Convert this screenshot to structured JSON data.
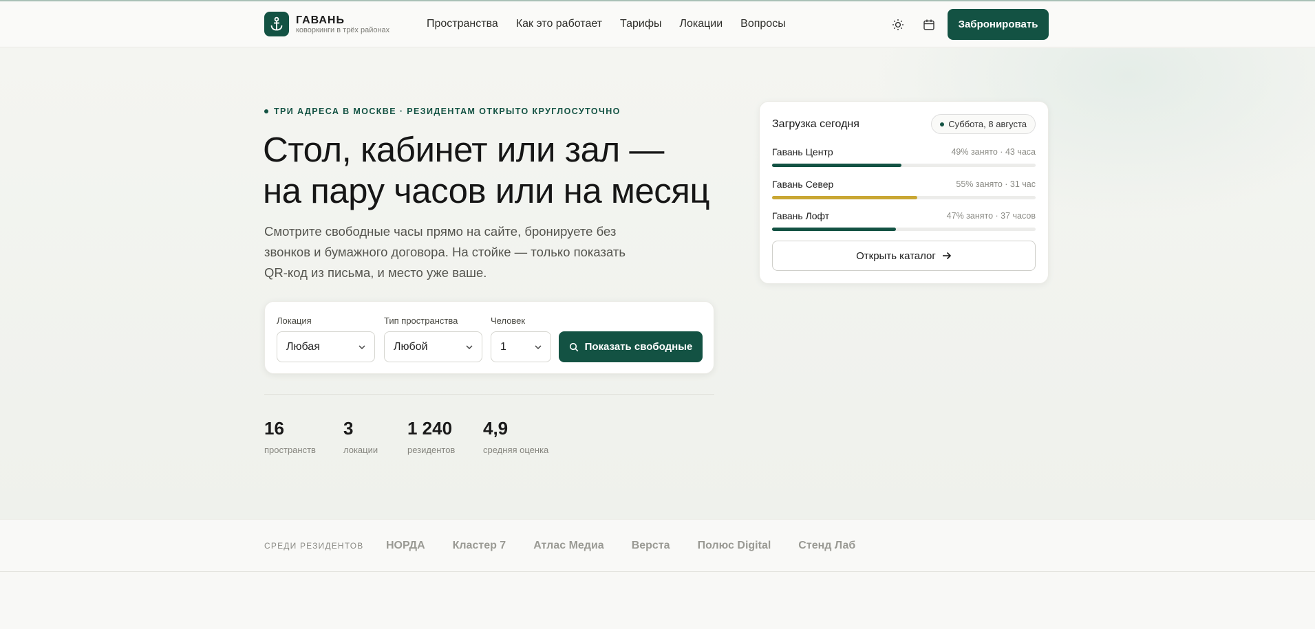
{
  "brand": {
    "name": "ГАВАНЬ",
    "tagline": "коворкинги в трёх районах",
    "accent_color": "#135243"
  },
  "nav": {
    "items": [
      {
        "label": "Пространства"
      },
      {
        "label": "Как это работает"
      },
      {
        "label": "Тарифы"
      },
      {
        "label": "Локации"
      },
      {
        "label": "Вопросы"
      }
    ],
    "theme_icon": "sun-icon",
    "calendar_icon": "calendar-icon",
    "book_label": "Забронировать"
  },
  "hero": {
    "eyebrow": "ТРИ АДРЕСА В МОСКВЕ · РЕЗИДЕНТАМ ОТКРЫТО КРУГЛОСУТОЧНО",
    "title_line1": "Стол, кабинет или зал —",
    "title_line2": "на пару часов или на месяц",
    "lead": "Смотрите свободные часы прямо на сайте, бронируете без звонков и бумажного договора. На стойке — только показать QR-код из письма, и место уже ваше."
  },
  "search": {
    "location": {
      "label": "Локация",
      "value": "Любая"
    },
    "space_type": {
      "label": "Тип пространства",
      "value": "Любой"
    },
    "people": {
      "label": "Человек",
      "value": "1"
    },
    "submit_label": "Показать свободные"
  },
  "stats": [
    {
      "value": "16",
      "label": "пространств"
    },
    {
      "value": "3",
      "label": "локации"
    },
    {
      "value": "1 240",
      "label": "резидентов"
    },
    {
      "value": "4,9",
      "label": "средняя оценка"
    }
  ],
  "load": {
    "title": "Загрузка сегодня",
    "date": "Суббота, 8 августа",
    "locations": [
      {
        "name": "Гавань Центр",
        "meta": "49% занято · 43 часа",
        "occupancy": 0.49,
        "color": "#135243"
      },
      {
        "name": "Гавань Север",
        "meta": "55% занято · 31 час",
        "occupancy": 0.55,
        "color": "#c9a733"
      },
      {
        "name": "Гавань Лофт",
        "meta": "47% занято · 37 часов",
        "occupancy": 0.47,
        "color": "#135243"
      }
    ],
    "catalog_label": "Открыть каталог"
  },
  "residents": {
    "label": "СРЕДИ РЕЗИДЕНТОВ",
    "items": [
      "НОРДА",
      "Кластер 7",
      "Атлас Медиа",
      "Верста",
      "Полюс Digital",
      "Стенд Лаб"
    ]
  }
}
